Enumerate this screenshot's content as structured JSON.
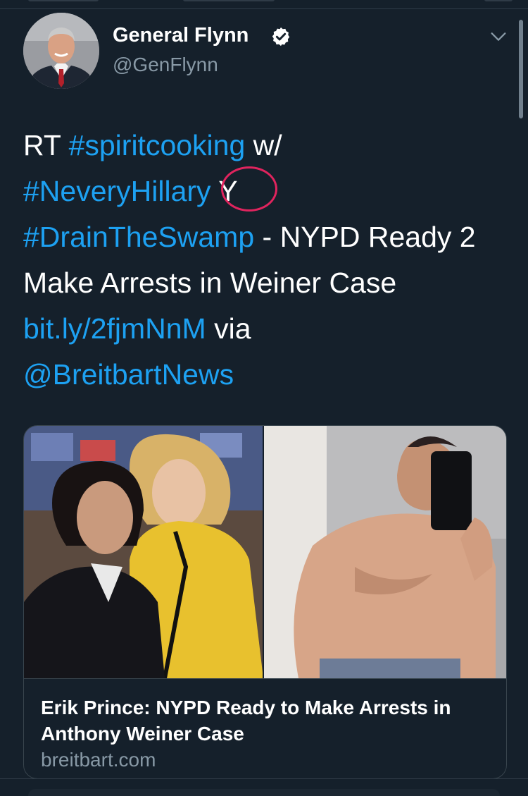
{
  "author": {
    "name": "General Flynn",
    "handle": "@GenFlynn",
    "verified": true
  },
  "tweet": {
    "segments": [
      {
        "text": "RT ",
        "link": false
      },
      {
        "text": "#spiritcooking",
        "link": true
      },
      {
        "text": " w/ ",
        "link": false
      },
      {
        "text": "#NeveryHillary",
        "link": true
      },
      {
        "text": " Y ",
        "link": false
      },
      {
        "text": "#DrainTheSwamp",
        "link": true
      },
      {
        "text": " - NYPD Ready 2 Make Arrests in Weiner Case ",
        "link": false
      },
      {
        "text": "bit.ly/2fjmNnM",
        "link": true
      },
      {
        "text": " via ",
        "link": false
      },
      {
        "text": "@BreitbartNews",
        "link": true
      }
    ]
  },
  "card": {
    "title": "Erik Prince: NYPD Ready to Make Arrests in Anthony Weiner Case",
    "domain": "breitbart.com"
  },
  "icons": {
    "verified": "verified-badge-icon",
    "menu": "chevron-down-icon"
  },
  "colors": {
    "background": "#15202b",
    "link": "#1da1f2",
    "secondary_text": "#8899a6",
    "annotation": "#e0245e"
  }
}
